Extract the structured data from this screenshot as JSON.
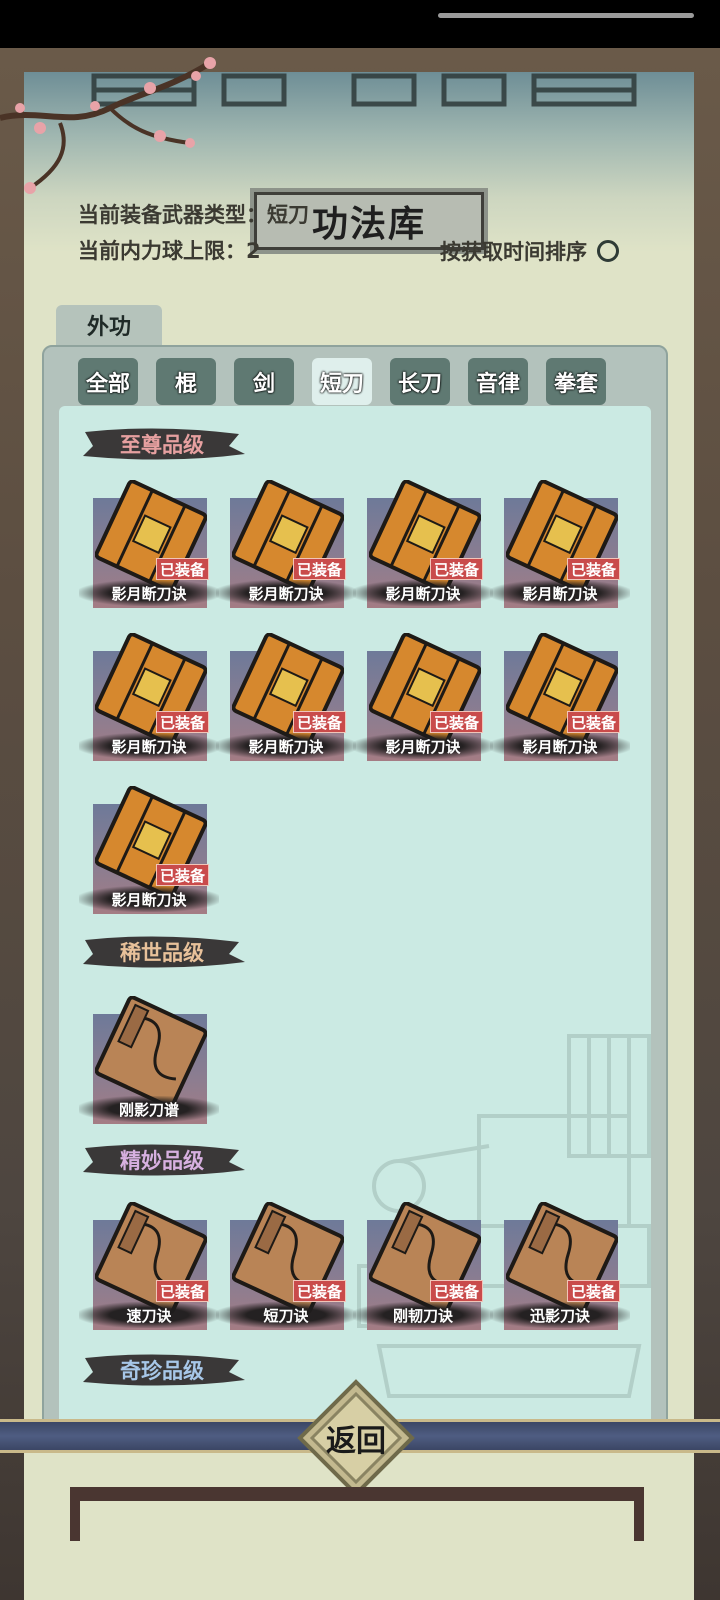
{
  "screen": {
    "title": "功法库",
    "weapon_type_line": "当前装备武器类型：短刀",
    "inner_power_line": "当前内力球上限：2",
    "sort_label": "按获取时间排序",
    "main_tab": "外功",
    "back_label": "返回"
  },
  "filters": [
    {
      "label": "全部",
      "active": false
    },
    {
      "label": "棍",
      "active": false
    },
    {
      "label": "剑",
      "active": false
    },
    {
      "label": "短刀",
      "active": true
    },
    {
      "label": "长刀",
      "active": false
    },
    {
      "label": "音律",
      "active": false
    },
    {
      "label": "拳套",
      "active": false
    }
  ],
  "grades": [
    {
      "name": "至尊品级",
      "items": [
        {
          "name": "影月断刀诀",
          "equipped_label": "已装备",
          "book": "golden"
        },
        {
          "name": "影月断刀诀",
          "equipped_label": "已装备",
          "book": "golden"
        },
        {
          "name": "影月断刀诀",
          "equipped_label": "已装备",
          "book": "golden"
        },
        {
          "name": "影月断刀诀",
          "equipped_label": "已装备",
          "book": "golden"
        },
        {
          "name": "影月断刀诀",
          "equipped_label": "已装备",
          "book": "golden"
        },
        {
          "name": "影月断刀诀",
          "equipped_label": "已装备",
          "book": "golden"
        },
        {
          "name": "影月断刀诀",
          "equipped_label": "已装备",
          "book": "golden"
        },
        {
          "name": "影月断刀诀",
          "equipped_label": "已装备",
          "book": "golden"
        },
        {
          "name": "影月断刀诀",
          "equipped_label": "已装备",
          "book": "golden"
        }
      ]
    },
    {
      "name": "稀世品级",
      "items": [
        {
          "name": "刚影刀谱",
          "equipped_label": "",
          "book": "scroll"
        }
      ]
    },
    {
      "name": "精妙品级",
      "items": [
        {
          "name": "速刀诀",
          "equipped_label": "已装备",
          "book": "scroll"
        },
        {
          "name": "短刀诀",
          "equipped_label": "已装备",
          "book": "scroll"
        },
        {
          "name": "刚韧刀诀",
          "equipped_label": "已装备",
          "book": "scroll"
        },
        {
          "name": "迅影刀诀",
          "equipped_label": "已装备",
          "book": "scroll"
        }
      ]
    },
    {
      "name": "奇珍品级",
      "items": []
    }
  ],
  "colors": {
    "panel": "#dfe3c7",
    "inner": "#cbeae3",
    "tab": "#5f7972",
    "equipped_badge": "#c94b4b",
    "grade_supreme": "#e6a0a0",
    "grade_rare": "#e8c19a",
    "grade_fine": "#d7b0e0"
  }
}
